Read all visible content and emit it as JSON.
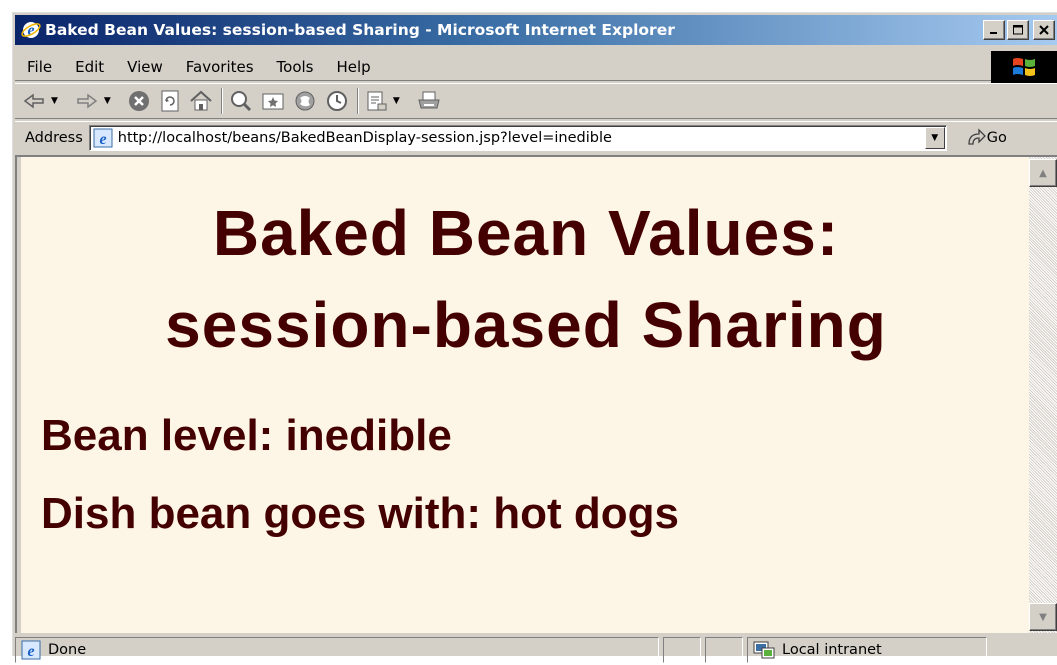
{
  "window": {
    "title": "Baked Bean Values: session-based Sharing - Microsoft Internet Explorer",
    "controls": {
      "minimize": "_",
      "maximize": "□",
      "close": "×"
    }
  },
  "menu": {
    "items": [
      {
        "label": "File"
      },
      {
        "label": "Edit"
      },
      {
        "label": "View"
      },
      {
        "label": "Favorites"
      },
      {
        "label": "Tools"
      },
      {
        "label": "Help"
      }
    ]
  },
  "toolbar": {
    "icons": [
      "back-icon",
      "forward-icon",
      "stop-icon",
      "refresh-icon",
      "home-icon",
      "search-icon",
      "favorites-icon",
      "media-icon",
      "history-icon",
      "mail-icon",
      "print-icon"
    ]
  },
  "address": {
    "label": "Address",
    "url": "http://localhost/beans/BakedBeanDisplay-session.jsp?level=inedible",
    "go_label": "Go"
  },
  "page": {
    "heading_line1": "Baked Bean Values:",
    "heading_line2": "session-based Sharing",
    "bean_level": "Bean level: inedible",
    "dish": "Dish bean goes with: hot dogs",
    "text_color": "#440000",
    "background": "#fdf5e6"
  },
  "status": {
    "text": "Done",
    "zone": "Local intranet"
  }
}
